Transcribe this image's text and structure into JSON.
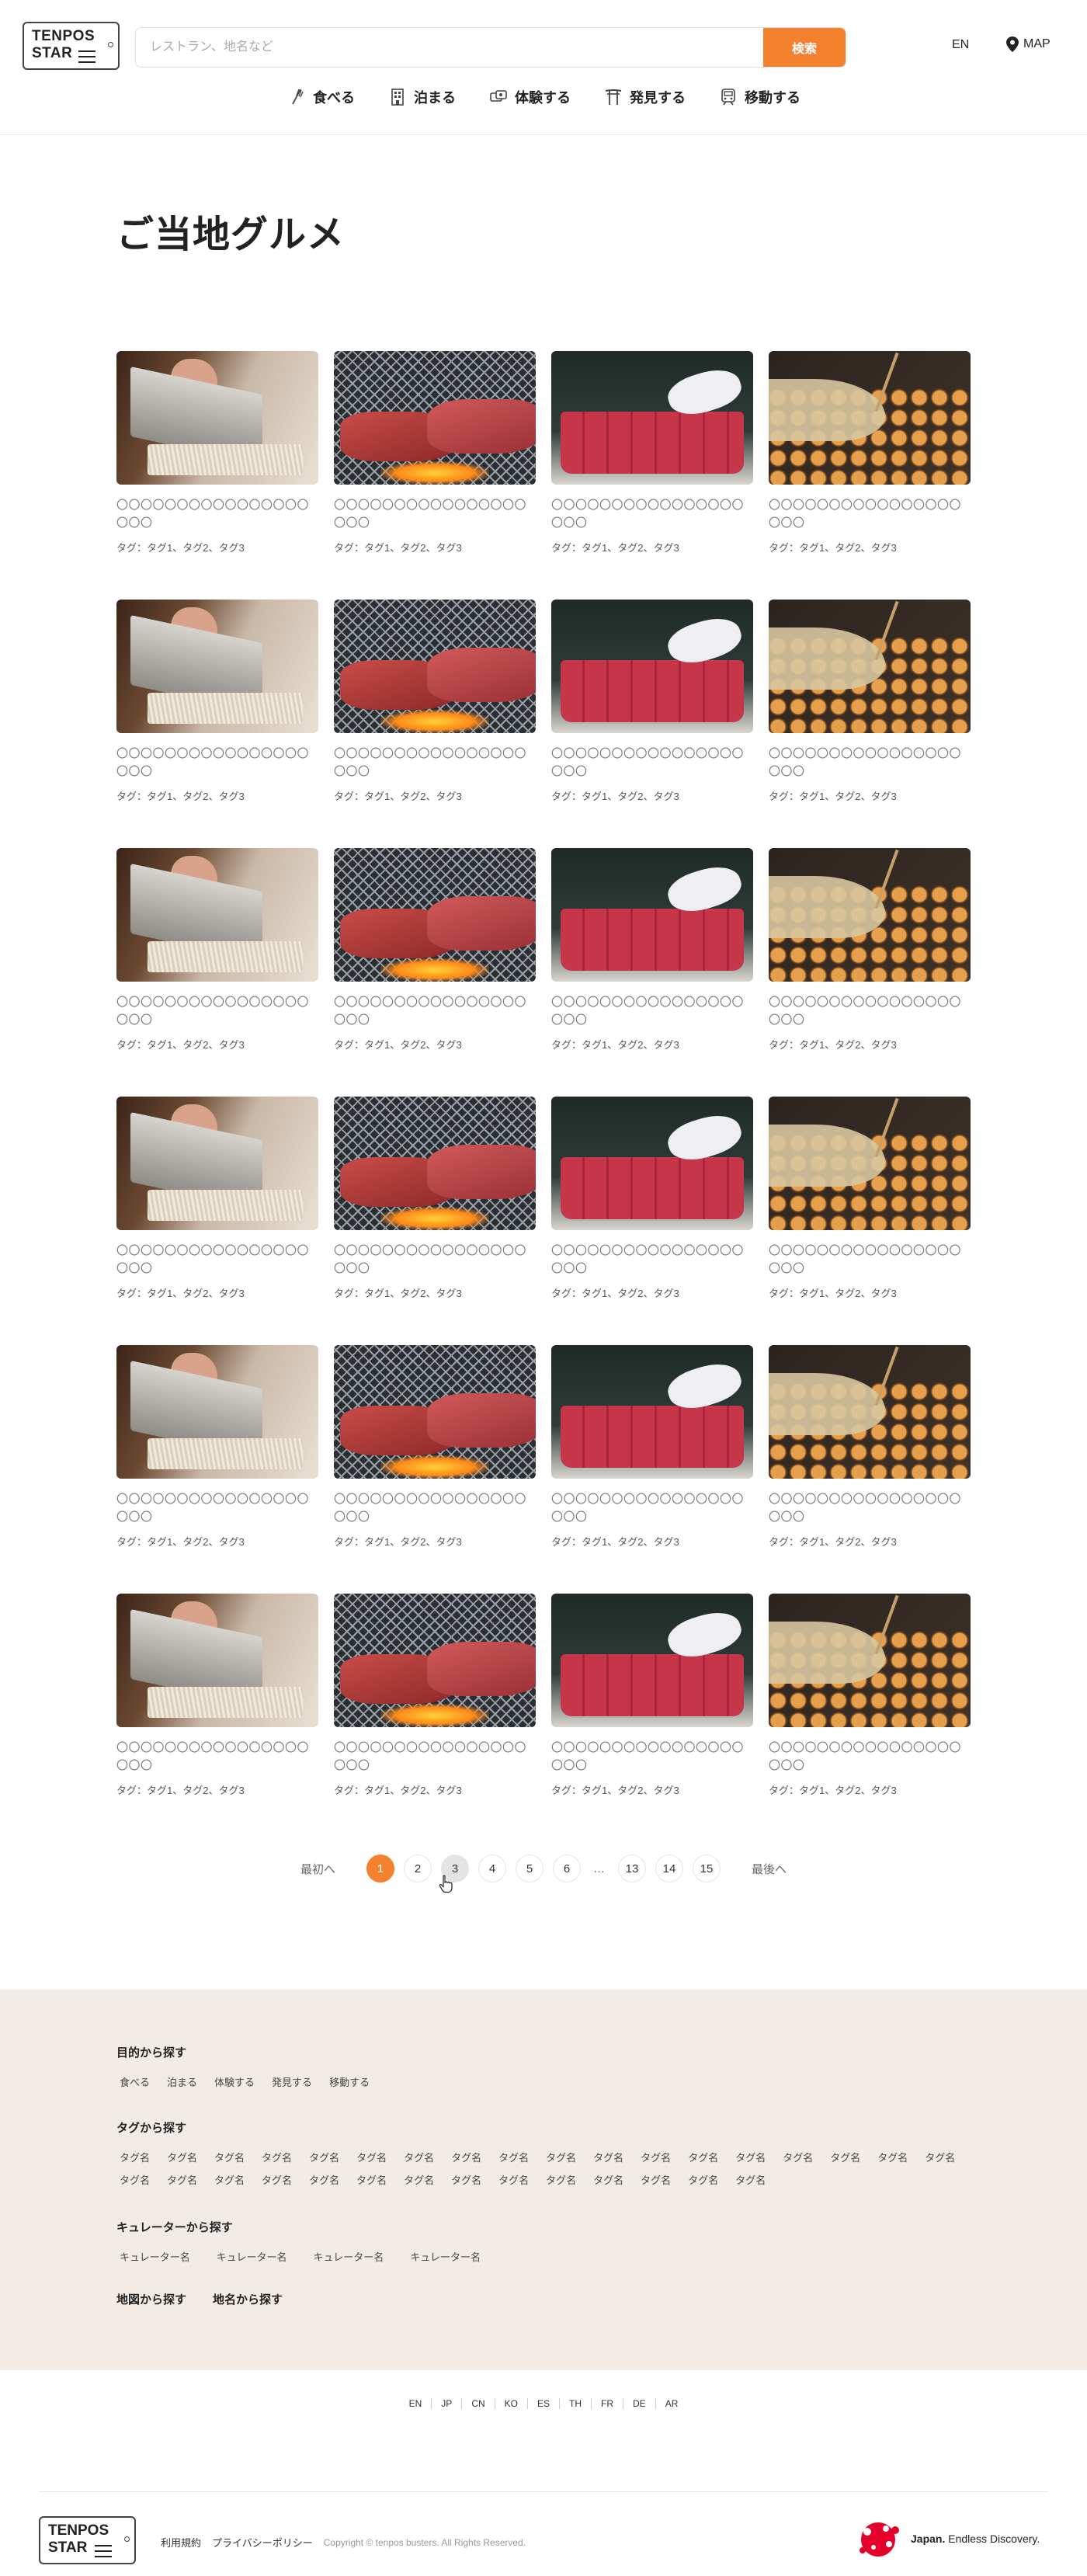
{
  "header": {
    "logo_line1": "TENPOS",
    "logo_line2": "STAR",
    "search_placeholder": "レストラン、地名など",
    "search_value": "",
    "search_button": "検索",
    "lang": "EN",
    "map": "MAP",
    "nav": [
      {
        "label": "食べる",
        "icon": "fork-icon"
      },
      {
        "label": "泊まる",
        "icon": "hotel-icon"
      },
      {
        "label": "体験する",
        "icon": "experience-icon"
      },
      {
        "label": "発見する",
        "icon": "torii-icon"
      },
      {
        "label": "移動する",
        "icon": "train-icon"
      }
    ]
  },
  "page_title": "ご当地グルメ",
  "cards": [
    {
      "image": "soba",
      "title": "〇〇〇〇〇〇〇〇〇〇〇〇〇〇〇〇〇〇〇",
      "tag": "タグ：タグ1、タグ2、タグ3"
    },
    {
      "image": "beef",
      "title": "〇〇〇〇〇〇〇〇〇〇〇〇〇〇〇〇〇〇〇",
      "tag": "タグ：タグ1、タグ2、タグ3"
    },
    {
      "image": "tuna",
      "title": "〇〇〇〇〇〇〇〇〇〇〇〇〇〇〇〇〇〇〇",
      "tag": "タグ：タグ1、タグ2、タグ3"
    },
    {
      "image": "takoyaki",
      "title": "〇〇〇〇〇〇〇〇〇〇〇〇〇〇〇〇〇〇〇",
      "tag": "タグ：タグ1、タグ2、タグ3"
    },
    {
      "image": "soba",
      "title": "〇〇〇〇〇〇〇〇〇〇〇〇〇〇〇〇〇〇〇",
      "tag": "タグ：タグ1、タグ2、タグ3"
    },
    {
      "image": "beef",
      "title": "〇〇〇〇〇〇〇〇〇〇〇〇〇〇〇〇〇〇〇",
      "tag": "タグ：タグ1、タグ2、タグ3"
    },
    {
      "image": "tuna",
      "title": "〇〇〇〇〇〇〇〇〇〇〇〇〇〇〇〇〇〇〇",
      "tag": "タグ：タグ1、タグ2、タグ3"
    },
    {
      "image": "takoyaki",
      "title": "〇〇〇〇〇〇〇〇〇〇〇〇〇〇〇〇〇〇〇",
      "tag": "タグ：タグ1、タグ2、タグ3"
    },
    {
      "image": "soba",
      "title": "〇〇〇〇〇〇〇〇〇〇〇〇〇〇〇〇〇〇〇",
      "tag": "タグ：タグ1、タグ2、タグ3"
    },
    {
      "image": "beef",
      "title": "〇〇〇〇〇〇〇〇〇〇〇〇〇〇〇〇〇〇〇",
      "tag": "タグ：タグ1、タグ2、タグ3"
    },
    {
      "image": "tuna",
      "title": "〇〇〇〇〇〇〇〇〇〇〇〇〇〇〇〇〇〇〇",
      "tag": "タグ：タグ1、タグ2、タグ3"
    },
    {
      "image": "takoyaki",
      "title": "〇〇〇〇〇〇〇〇〇〇〇〇〇〇〇〇〇〇〇",
      "tag": "タグ：タグ1、タグ2、タグ3"
    },
    {
      "image": "soba",
      "title": "〇〇〇〇〇〇〇〇〇〇〇〇〇〇〇〇〇〇〇",
      "tag": "タグ：タグ1、タグ2、タグ3"
    },
    {
      "image": "beef",
      "title": "〇〇〇〇〇〇〇〇〇〇〇〇〇〇〇〇〇〇〇",
      "tag": "タグ：タグ1、タグ2、タグ3"
    },
    {
      "image": "tuna",
      "title": "〇〇〇〇〇〇〇〇〇〇〇〇〇〇〇〇〇〇〇",
      "tag": "タグ：タグ1、タグ2、タグ3"
    },
    {
      "image": "takoyaki",
      "title": "〇〇〇〇〇〇〇〇〇〇〇〇〇〇〇〇〇〇〇",
      "tag": "タグ：タグ1、タグ2、タグ3"
    },
    {
      "image": "soba",
      "title": "〇〇〇〇〇〇〇〇〇〇〇〇〇〇〇〇〇〇〇",
      "tag": "タグ：タグ1、タグ2、タグ3"
    },
    {
      "image": "beef",
      "title": "〇〇〇〇〇〇〇〇〇〇〇〇〇〇〇〇〇〇〇",
      "tag": "タグ：タグ1、タグ2、タグ3"
    },
    {
      "image": "tuna",
      "title": "〇〇〇〇〇〇〇〇〇〇〇〇〇〇〇〇〇〇〇",
      "tag": "タグ：タグ1、タグ2、タグ3"
    },
    {
      "image": "takoyaki",
      "title": "〇〇〇〇〇〇〇〇〇〇〇〇〇〇〇〇〇〇〇",
      "tag": "タグ：タグ1、タグ2、タグ3"
    },
    {
      "image": "soba",
      "title": "〇〇〇〇〇〇〇〇〇〇〇〇〇〇〇〇〇〇〇",
      "tag": "タグ：タグ1、タグ2、タグ3"
    },
    {
      "image": "beef",
      "title": "〇〇〇〇〇〇〇〇〇〇〇〇〇〇〇〇〇〇〇",
      "tag": "タグ：タグ1、タグ2、タグ3"
    },
    {
      "image": "tuna",
      "title": "〇〇〇〇〇〇〇〇〇〇〇〇〇〇〇〇〇〇〇",
      "tag": "タグ：タグ1、タグ2、タグ3"
    },
    {
      "image": "takoyaki",
      "title": "〇〇〇〇〇〇〇〇〇〇〇〇〇〇〇〇〇〇〇",
      "tag": "タグ：タグ1、タグ2、タグ3"
    }
  ],
  "pagination": {
    "first": "最初へ",
    "last": "最後へ",
    "pages": [
      "1",
      "2",
      "3",
      "4",
      "5",
      "6"
    ],
    "dots": "…",
    "tail_pages": [
      "13",
      "14",
      "15"
    ],
    "current": "1",
    "hovered": "3"
  },
  "footer": {
    "purpose_heading": "目的から探す",
    "purpose_links": [
      "食べる",
      "泊まる",
      "体験する",
      "発見する",
      "移動する"
    ],
    "tag_heading": "タグから探す",
    "tag_links": [
      "タグ名",
      "タグ名",
      "タグ名",
      "タグ名",
      "タグ名",
      "タグ名",
      "タグ名",
      "タグ名",
      "タグ名",
      "タグ名",
      "タグ名",
      "タグ名",
      "タグ名",
      "タグ名",
      "タグ名",
      "タグ名",
      "タグ名",
      "タグ名",
      "タグ名",
      "タグ名",
      "タグ名",
      "タグ名",
      "タグ名",
      "タグ名",
      "タグ名",
      "タグ名",
      "タグ名",
      "タグ名",
      "タグ名",
      "タグ名",
      "タグ名",
      "タグ名"
    ],
    "curator_heading": "キュレーターから探す",
    "curator_links": [
      "キュレーター名",
      "キュレーター名",
      "キュレーター名",
      "キュレーター名"
    ],
    "bottom_links": [
      "地図から探す",
      "地名から探す"
    ],
    "languages": [
      "EN",
      "JP",
      "CN",
      "KO",
      "ES",
      "TH",
      "FR",
      "DE",
      "AR"
    ],
    "terms": "利用規約",
    "privacy": "プライバシーポリシー",
    "copyright": "Copyright © tenpos busters. All Rights Reserved.",
    "japan_brand": "Japan.",
    "japan_tagline": "Endless Discovery."
  },
  "colors": {
    "accent": "#f4812e",
    "footer_bg": "#f2ebe6"
  }
}
